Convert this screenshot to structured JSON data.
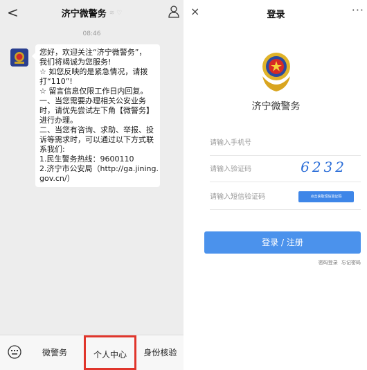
{
  "left": {
    "header": {
      "back_glyph": "<",
      "title": "济宁微警务",
      "title_suffix": "≋ ♡"
    },
    "timestamp": "08:46",
    "message_lines": [
      "您好，欢迎关注“济宁微警务”，",
      "我们将竭诚为您服务!",
      "☆ 如您反映的是紧急情况，请拨",
      "打“110”!",
      "☆ 留言信息仅限工作日内回复。",
      " 一、当您需要办理相关公安业务",
      "时，请优先尝试左下角【微警务】",
      "进行办理。",
      "二、当您有咨询、求助、举报、投",
      "诉等需求时，可以通过以下方式联",
      "系我们:",
      "1.民生警务热线：9600110",
      "2.济宁市公安局（http://ga.jining.",
      "gov.cn/）"
    ],
    "menu": [
      "微警务",
      "个人中心",
      "身份核验"
    ],
    "icons": [
      "chevron-left-icon",
      "person-icon",
      "keyboard-icon",
      "police-avatar-icon"
    ]
  },
  "right": {
    "header": {
      "close_glyph": "×",
      "title": "登录",
      "more_glyph": "···"
    },
    "app_name": "济宁微警务",
    "fields": {
      "phone_placeholder": "请输入手机号",
      "captcha_placeholder": "请输入验证码",
      "captcha_value": "6232",
      "sms_placeholder": "请输入短信验证码",
      "sms_button": "点击获取短信验证码"
    },
    "login_button": "登录 / 注册",
    "links": [
      "密码登录",
      "忘记密码"
    ],
    "colors": {
      "accent": "#4b92ec",
      "highlight_border": "#e0352b"
    }
  }
}
